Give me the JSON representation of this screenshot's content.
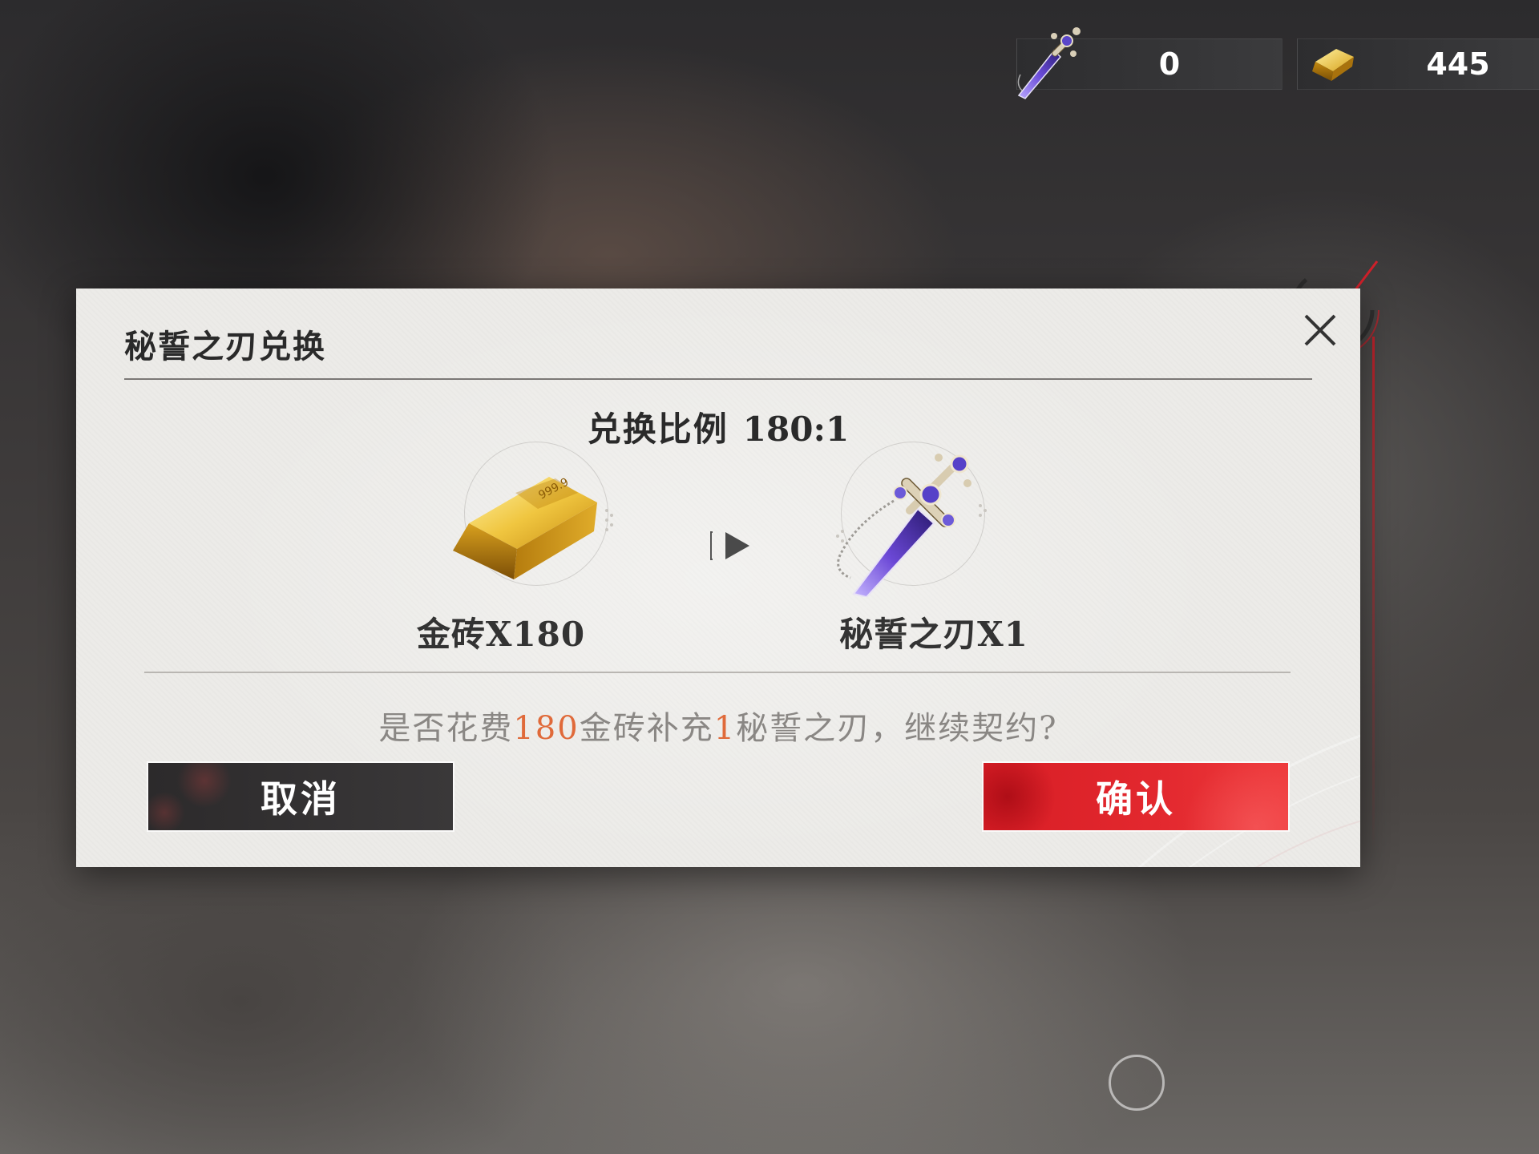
{
  "top_bar": {
    "blade_count": "0",
    "gold_count": "445"
  },
  "dialog": {
    "title": "秘誓之刃兑换",
    "ratio_label": "兑换比例",
    "ratio_value": "180:1",
    "cost_item": {
      "label": "金砖X180",
      "icon": "gold-bar-icon"
    },
    "reward_item": {
      "label": "秘誓之刃X1",
      "icon": "blade-icon"
    },
    "prompt": {
      "part1": "是否花费",
      "cost_amount": "180",
      "part2": "金砖补充",
      "reward_amount": "1",
      "part3": "秘誓之刃，继续契约?"
    },
    "cancel_label": "取消",
    "confirm_label": "确认"
  },
  "colors": {
    "accent_red": "#e3292f",
    "highlight_orange": "#e06a3a",
    "dialog_bg": "#ecebe8"
  }
}
